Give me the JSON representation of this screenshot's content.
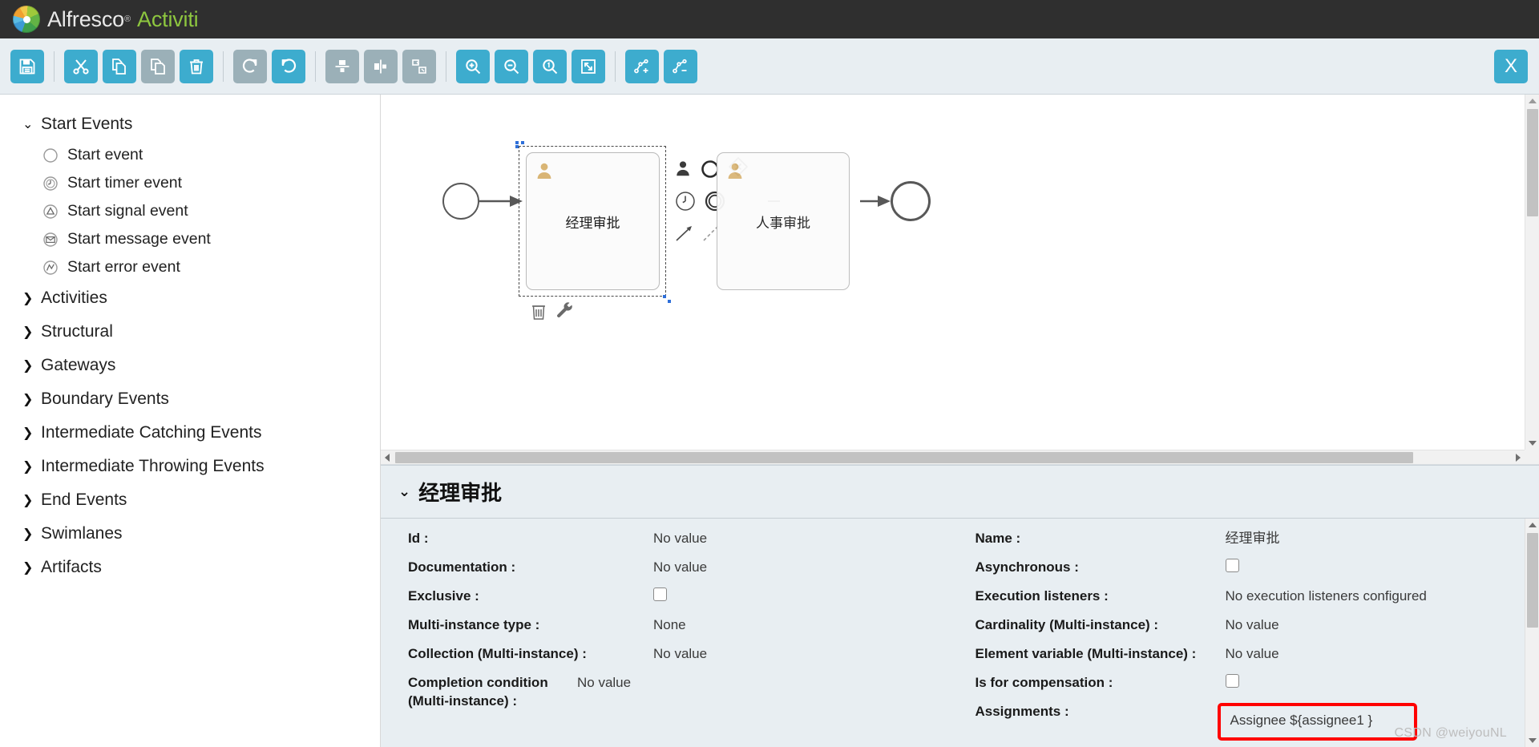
{
  "brand": {
    "name_primary": "Alfresco",
    "registered": "®",
    "name_secondary": "Activiti",
    "logo_icon": "alfresco-logo-icon"
  },
  "toolbar": {
    "buttons": [
      {
        "name": "save-button",
        "icon": "save-icon",
        "label": "Save",
        "enabled": true
      },
      {
        "name": "cut-button",
        "icon": "scissors-icon",
        "label": "Cut",
        "enabled": true
      },
      {
        "name": "copy-button",
        "icon": "copy-icon",
        "label": "Copy",
        "enabled": true
      },
      {
        "name": "paste-button",
        "icon": "paste-icon",
        "label": "Paste",
        "enabled": false
      },
      {
        "name": "delete-button",
        "icon": "trash-icon",
        "label": "Delete",
        "enabled": true
      },
      {
        "name": "redo-button",
        "icon": "redo-icon",
        "label": "Redo",
        "enabled": false
      },
      {
        "name": "undo-button",
        "icon": "undo-icon",
        "label": "Undo",
        "enabled": true
      },
      {
        "name": "align-vertical-button",
        "icon": "align-vertical-icon",
        "label": "Align vertical",
        "enabled": false
      },
      {
        "name": "align-horizontal-button",
        "icon": "align-horizontal-icon",
        "label": "Align horizontal",
        "enabled": false
      },
      {
        "name": "same-size-button",
        "icon": "same-size-icon",
        "label": "Same size",
        "enabled": false
      },
      {
        "name": "zoom-in-button",
        "icon": "zoom-in-icon",
        "label": "Zoom in",
        "enabled": true
      },
      {
        "name": "zoom-out-button",
        "icon": "zoom-out-icon",
        "label": "Zoom out",
        "enabled": true
      },
      {
        "name": "zoom-actual-button",
        "icon": "zoom-actual-icon",
        "label": "Zoom actual size",
        "enabled": true
      },
      {
        "name": "zoom-fit-button",
        "icon": "zoom-fit-icon",
        "label": "Zoom to fit",
        "enabled": true
      },
      {
        "name": "add-bendpoint-button",
        "icon": "add-bendpoint-icon",
        "label": "Add bendpoint",
        "enabled": true
      },
      {
        "name": "remove-bendpoint-button",
        "icon": "remove-bendpoint-icon",
        "label": "Remove bendpoint",
        "enabled": true
      }
    ],
    "close_label": "X"
  },
  "palette": {
    "groups": [
      {
        "label": "Start Events",
        "expanded": true,
        "caret": "⌄",
        "items": [
          {
            "label": "Start event",
            "icon": "start-event-icon"
          },
          {
            "label": "Start timer event",
            "icon": "start-timer-event-icon"
          },
          {
            "label": "Start signal event",
            "icon": "start-signal-event-icon"
          },
          {
            "label": "Start message event",
            "icon": "start-message-event-icon"
          },
          {
            "label": "Start error event",
            "icon": "start-error-event-icon"
          }
        ]
      },
      {
        "label": "Activities",
        "expanded": false,
        "caret": "❯",
        "items": []
      },
      {
        "label": "Structural",
        "expanded": false,
        "caret": "❯",
        "items": []
      },
      {
        "label": "Gateways",
        "expanded": false,
        "caret": "❯",
        "items": []
      },
      {
        "label": "Boundary Events",
        "expanded": false,
        "caret": "❯",
        "items": []
      },
      {
        "label": "Intermediate Catching Events",
        "expanded": false,
        "caret": "❯",
        "items": []
      },
      {
        "label": "Intermediate Throwing Events",
        "expanded": false,
        "caret": "❯",
        "items": []
      },
      {
        "label": "End Events",
        "expanded": false,
        "caret": "❯",
        "items": []
      },
      {
        "label": "Swimlanes",
        "expanded": false,
        "caret": "❯",
        "items": []
      },
      {
        "label": "Artifacts",
        "expanded": false,
        "caret": "❯",
        "items": []
      }
    ]
  },
  "canvas": {
    "nodes": [
      {
        "name": "start-event-node",
        "type": "start-event",
        "label": ""
      },
      {
        "name": "user-task-manager-approval",
        "type": "user-task",
        "label": "经理审批",
        "selected": true
      },
      {
        "name": "user-task-hr-approval",
        "type": "user-task",
        "label": "人事审批",
        "selected": false
      },
      {
        "name": "end-event-node",
        "type": "end-event",
        "label": ""
      }
    ],
    "selection_tools": [
      {
        "name": "delete-shape-icon",
        "label": "Delete"
      },
      {
        "name": "morph-shape-icon",
        "label": "Morph shape"
      }
    ],
    "quick_menu": [
      {
        "name": "quick-user-task-icon",
        "label": "User task"
      },
      {
        "name": "quick-none-event-icon",
        "label": "None intermediate event"
      },
      {
        "name": "quick-timer-event-icon",
        "label": "Timer catching event"
      },
      {
        "name": "quick-end-event-icon",
        "label": "End event"
      },
      {
        "name": "quick-gateway-icon",
        "label": "Gateway"
      },
      {
        "name": "quick-sequenceflow-icon",
        "label": "Sequence flow"
      },
      {
        "name": "quick-association-icon",
        "label": "Association"
      }
    ]
  },
  "properties": {
    "title": "经理审批",
    "caret": "⌄",
    "left_rows": [
      {
        "label": "Id :",
        "value": "No value",
        "kind": "text"
      },
      {
        "label": "Documentation :",
        "value": "No value",
        "kind": "text"
      },
      {
        "label": "Exclusive :",
        "value": "",
        "kind": "checkbox",
        "checked": false
      },
      {
        "label": "Multi-instance type :",
        "value": "None",
        "kind": "text"
      },
      {
        "label": "Collection (Multi-instance) :",
        "value": "No value",
        "kind": "text"
      },
      {
        "label": "Completion condition (Multi-instance) :",
        "value": "No value",
        "kind": "text"
      }
    ],
    "right_rows": [
      {
        "label": "Name :",
        "value": "经理审批",
        "kind": "text"
      },
      {
        "label": "Asynchronous :",
        "value": "",
        "kind": "checkbox",
        "checked": false
      },
      {
        "label": "Execution listeners :",
        "value": "No execution listeners configured",
        "kind": "text"
      },
      {
        "label": "Cardinality (Multi-instance) :",
        "value": "No value",
        "kind": "text"
      },
      {
        "label": "Element variable (Multi-instance) :",
        "value": "No value",
        "kind": "text"
      },
      {
        "label": "Is for compensation :",
        "value": "",
        "kind": "checkbox",
        "checked": false
      },
      {
        "label": "Assignments :",
        "value": "Assignee ${assignee1 }",
        "kind": "highlighted"
      }
    ]
  },
  "watermark": "CSDN @weiyouNL",
  "colors": {
    "accent": "#3dacce",
    "accent_disabled": "#9bb0b8",
    "brand_green": "#8dc63f",
    "brand_bar": "#2f2f2f",
    "panel_bg": "#e8eef2",
    "highlight": "#ff0000"
  }
}
